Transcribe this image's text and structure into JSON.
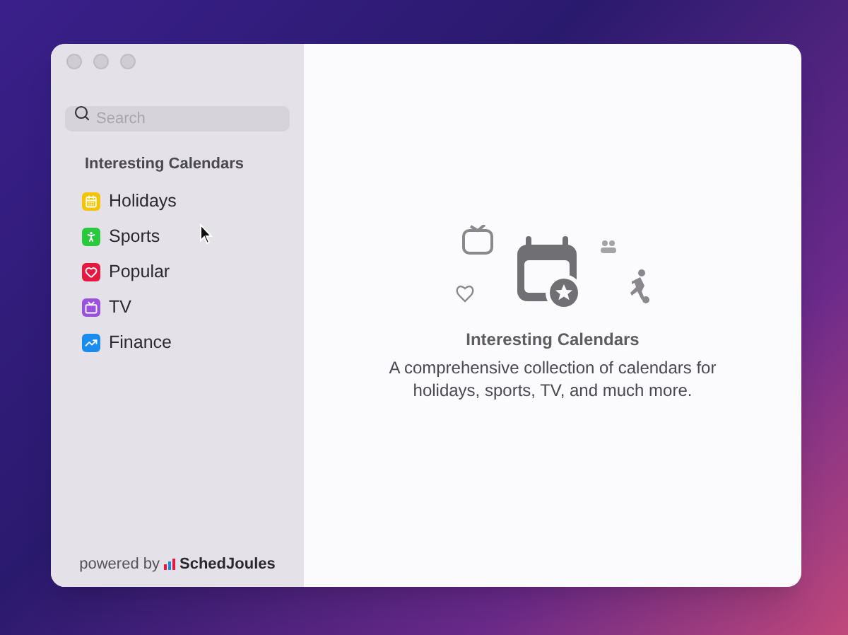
{
  "search": {
    "placeholder": "Search"
  },
  "sidebar": {
    "heading": "Interesting Calendars",
    "items": [
      {
        "label": "Holidays",
        "kind": "holidays",
        "color": "#f5c400",
        "selected": false
      },
      {
        "label": "Sports",
        "kind": "sports",
        "color": "#2ac83c",
        "selected": false
      },
      {
        "label": "Popular",
        "kind": "popular",
        "color": "#e5193f",
        "selected": false
      },
      {
        "label": "TV",
        "kind": "tv",
        "color": "#9b51e0",
        "selected": false
      },
      {
        "label": "Finance",
        "kind": "finance",
        "color": "#1a8cf0",
        "selected": false
      }
    ]
  },
  "footer": {
    "prefix": "powered by",
    "brand": "SchedJoules"
  },
  "main": {
    "title": "Interesting Calendars",
    "description": "A comprehensive collection of calendars for holidays, sports, TV, and much more."
  }
}
